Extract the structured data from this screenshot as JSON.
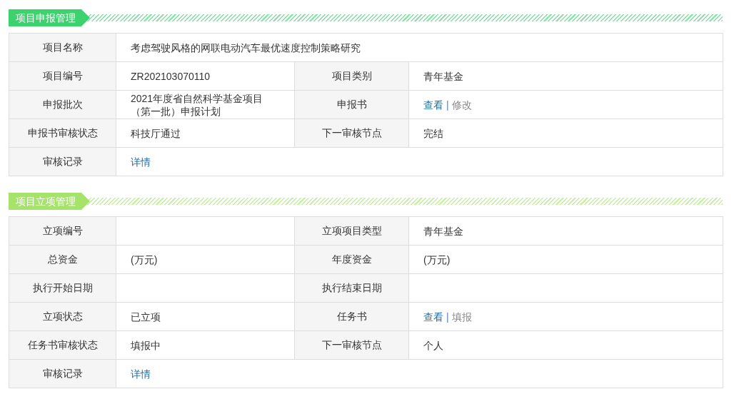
{
  "sections": [
    {
      "title": "项目申报管理",
      "color": "#3cd36e",
      "rows": [
        [
          {
            "label": "项目名称",
            "value": [
              {
                "kind": "text",
                "text": "考虑驾驶风格的网联电动汽车最优速度控制策略研究"
              }
            ]
          }
        ],
        [
          {
            "label": "项目编号",
            "value": [
              {
                "kind": "text",
                "text": "ZR202103070110"
              }
            ]
          },
          {
            "label": "项目类别",
            "value": [
              {
                "kind": "text",
                "text": "青年基金"
              }
            ]
          }
        ],
        [
          {
            "label": "申报批次",
            "value": [
              {
                "kind": "text",
                "text": "2021年度省自然科学基金项目（第一批）申报计划"
              }
            ]
          },
          {
            "label": "申报书",
            "value": [
              {
                "kind": "link",
                "text": "查看"
              },
              {
                "kind": "separator",
                "text": "|"
              },
              {
                "kind": "muted-link",
                "text": "修改"
              }
            ]
          }
        ],
        [
          {
            "label": "申报书审核状态",
            "value": [
              {
                "kind": "text",
                "text": "科技厅通过"
              }
            ]
          },
          {
            "label": "下一审核节点",
            "value": [
              {
                "kind": "text",
                "text": "完结"
              }
            ]
          }
        ],
        [
          {
            "label": "审核记录",
            "value": [
              {
                "kind": "link",
                "text": "详情"
              }
            ]
          }
        ]
      ]
    },
    {
      "title": "项目立项管理",
      "color": "#a6e36a",
      "rows": [
        [
          {
            "label": "立项编号"
          },
          {
            "label": "立项项目类型",
            "value": [
              {
                "kind": "text",
                "text": "青年基金"
              }
            ]
          }
        ],
        [
          {
            "label": "总资金",
            "value": [
              {
                "kind": "text",
                "text": "(万元)"
              }
            ]
          },
          {
            "label": "年度资金",
            "value": [
              {
                "kind": "text",
                "text": "(万元)"
              }
            ]
          }
        ],
        [
          {
            "label": "执行开始日期"
          },
          {
            "label": "执行结束日期"
          }
        ],
        [
          {
            "label": "立项状态",
            "value": [
              {
                "kind": "text",
                "text": "已立项"
              }
            ]
          },
          {
            "label": "任务书",
            "value": [
              {
                "kind": "link",
                "text": "查看"
              },
              {
                "kind": "separator",
                "text": "|"
              },
              {
                "kind": "muted-link",
                "text": "填报"
              }
            ]
          }
        ],
        [
          {
            "label": "任务书审核状态",
            "value": [
              {
                "kind": "text",
                "text": "填报中"
              }
            ]
          },
          {
            "label": "下一审核节点",
            "value": [
              {
                "kind": "text",
                "text": "个人"
              }
            ]
          }
        ],
        [
          {
            "label": "审核记录",
            "value": [
              {
                "kind": "link",
                "text": "详情"
              }
            ]
          }
        ]
      ]
    }
  ]
}
